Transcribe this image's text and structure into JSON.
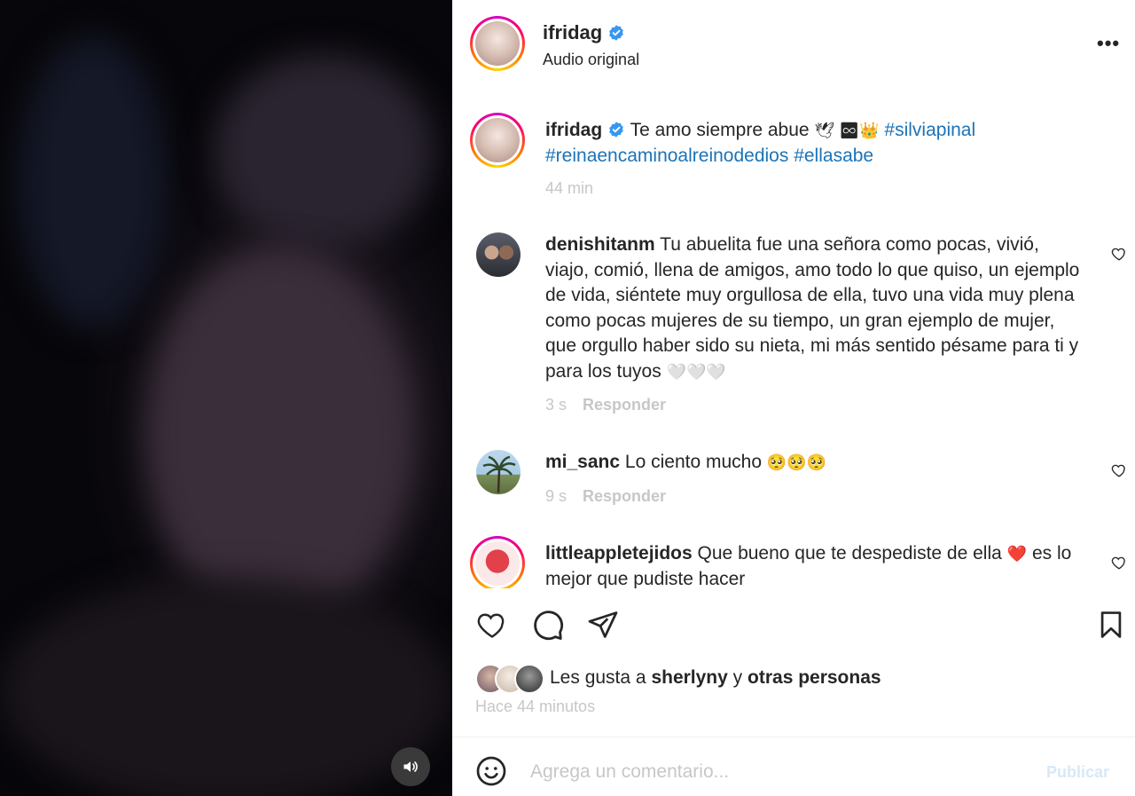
{
  "post": {
    "username": "ifridag",
    "audio": "Audio original",
    "more_icon": "more-horizontal-icon",
    "verified_color": "#3897f0"
  },
  "caption": {
    "username": "ifridag",
    "text": "Te amo siempre abue",
    "emojis": "🕊 ♾👑",
    "hashtags": [
      "#silviapinal",
      "#reinaencaminoalreinodedios",
      "#ellasabe"
    ],
    "time": "44 min"
  },
  "comments": [
    {
      "username": "denishitanm",
      "text": "Tu abuelita fue una señora como pocas, vivió, viajo, comió, llena de amigos, amo todo lo que quiso, un ejemplo de vida, siéntete muy orgullosa de ella, tuvo una vida muy plena como pocas mujeres de su tiempo, un gran ejemplo de mujer, que orgullo haber sido su nieta, mi más sentido pésame para ti y para los tuyos",
      "emojis": "🤍🤍🤍",
      "time": "3 s",
      "reply": "Responder"
    },
    {
      "username": "mi_sanc",
      "text": "Lo ciento mucho",
      "emojis": "🥺🥺🥺",
      "time": "9 s",
      "reply": "Responder"
    },
    {
      "username": "littleappletejidos",
      "text": "Que bueno que te despediste de ella",
      "emojis": "❤️",
      "text2": "es lo mejor que pudiste hacer"
    }
  ],
  "likes": {
    "prefix": "Les gusta a",
    "user": "sherlyny",
    "joiner": "y",
    "others": "otras personas"
  },
  "time_ago": "Hace 44 minutos",
  "add_comment": {
    "placeholder": "Agrega un comentario...",
    "publish": "Publicar"
  },
  "colors": {
    "link": "#1c73b7",
    "muted": "#c7c7c7",
    "text": "#262626"
  }
}
